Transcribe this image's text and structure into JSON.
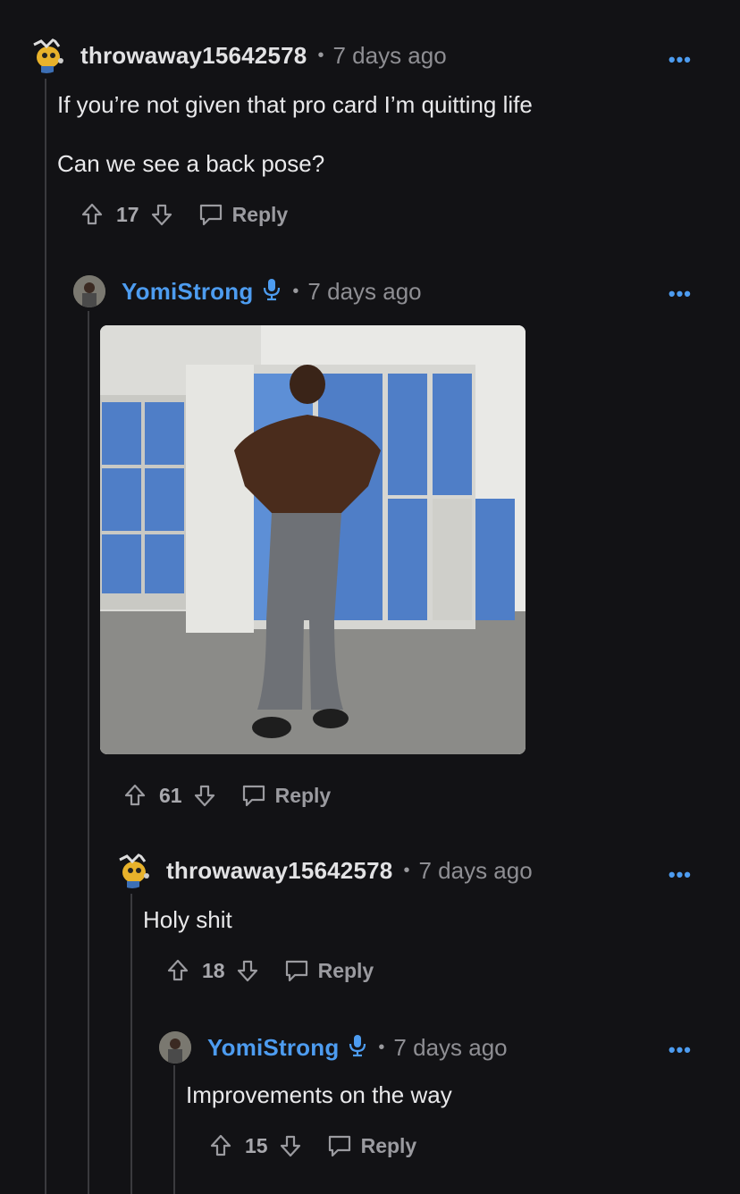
{
  "comments": [
    {
      "username": "throwaway15642578",
      "time": "7 days ago",
      "text_lines": [
        "If you’re not given that pro card I’m quitting life",
        "Can we see a back pose?"
      ],
      "votes": "17",
      "reply_label": "Reply",
      "more": "•••"
    },
    {
      "username": "YomiStrong",
      "time": "7 days ago",
      "image_alt": "Man posing back double biceps in locker room",
      "votes": "61",
      "reply_label": "Reply",
      "more": "•••"
    },
    {
      "username": "throwaway15642578",
      "time": "7 days ago",
      "text": "Holy shit",
      "votes": "18",
      "reply_label": "Reply",
      "more": "•••"
    },
    {
      "username": "YomiStrong",
      "time": "7 days ago",
      "text": "Improvements on the way",
      "votes": "15",
      "reply_label": "Reply",
      "more": "•••"
    }
  ],
  "separator": "•",
  "colors": {
    "background": "#121215",
    "op_blue": "#4d9cf0",
    "muted": "#8e8e93"
  },
  "icons": [
    "upvote-icon",
    "downvote-icon",
    "comment-bubble-icon",
    "mic-icon",
    "more-options-icon"
  ]
}
